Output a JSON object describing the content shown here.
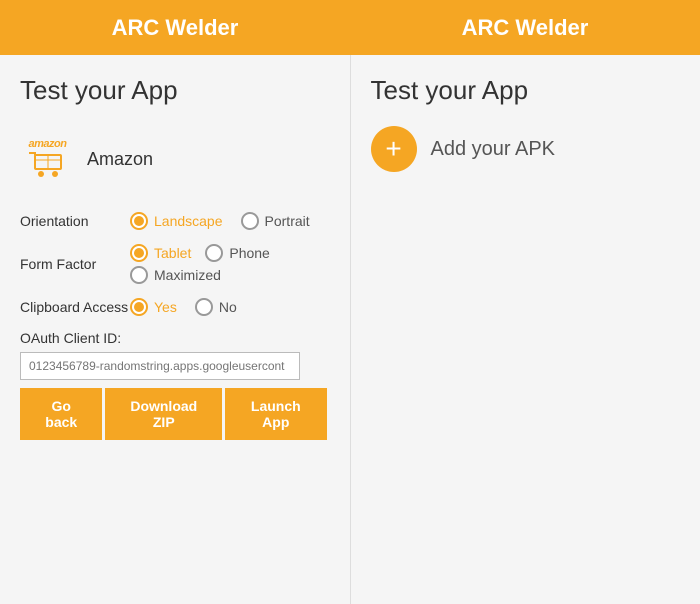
{
  "header": {
    "left_title": "ARC Welder",
    "right_title": "ARC Welder"
  },
  "left_panel": {
    "title": "Test your App",
    "app": {
      "name": "Amazon"
    },
    "orientation": {
      "label": "Orientation",
      "options": [
        {
          "id": "landscape",
          "label": "Landscape",
          "checked": true
        },
        {
          "id": "portrait",
          "label": "Portrait",
          "checked": false
        }
      ]
    },
    "form_factor": {
      "label": "Form Factor",
      "options": [
        {
          "id": "tablet",
          "label": "Tablet",
          "checked": true
        },
        {
          "id": "phone",
          "label": "Phone",
          "checked": false
        },
        {
          "id": "maximized",
          "label": "Maximized",
          "checked": false
        }
      ]
    },
    "clipboard": {
      "label": "Clipboard Access",
      "options": [
        {
          "id": "yes",
          "label": "Yes",
          "checked": true
        },
        {
          "id": "no",
          "label": "No",
          "checked": false
        }
      ]
    },
    "oauth": {
      "label": "OAuth Client ID:",
      "placeholder": "0123456789-randomstring.apps.googleusercont"
    },
    "buttons": {
      "back": "Go back",
      "download": "Download ZIP",
      "launch": "Launch App"
    }
  },
  "right_panel": {
    "title": "Test your App",
    "add_apk": {
      "icon": "+",
      "label": "Add your APK"
    }
  }
}
